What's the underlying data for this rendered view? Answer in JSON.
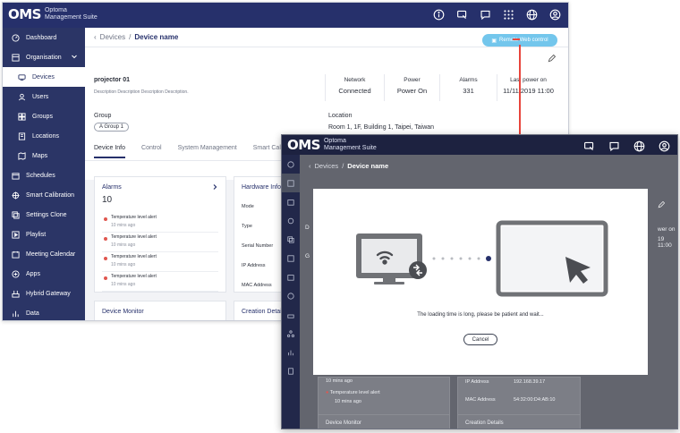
{
  "brand": {
    "logo": "OMS",
    "name_line1": "Optoma",
    "name_line2": "Management Suite"
  },
  "sidebar": {
    "items": [
      {
        "label": "Dashboard",
        "icon": "dashboard-icon"
      },
      {
        "label": "Organisation",
        "icon": "organisation-icon"
      },
      {
        "label": "Devices",
        "icon": "devices-icon"
      },
      {
        "label": "Users",
        "icon": "users-icon"
      },
      {
        "label": "Groups",
        "icon": "groups-icon"
      },
      {
        "label": "Locations",
        "icon": "locations-icon"
      },
      {
        "label": "Maps",
        "icon": "maps-icon"
      },
      {
        "label": "Schedules",
        "icon": "schedules-icon"
      },
      {
        "label": "Smart Calibration",
        "icon": "calibration-icon"
      },
      {
        "label": "Settings Clone",
        "icon": "clone-icon"
      },
      {
        "label": "Playlist",
        "icon": "playlist-icon"
      },
      {
        "label": "Meeting Calendar",
        "icon": "calendar-icon"
      },
      {
        "label": "Apps",
        "icon": "apps-icon"
      },
      {
        "label": "Hybrid Gateway",
        "icon": "gateway-icon"
      },
      {
        "label": "Data",
        "icon": "data-icon"
      }
    ]
  },
  "breadcrumb": {
    "parent": "Devices",
    "separator": "/",
    "current": "Device name"
  },
  "remote_button": "Remote Web control",
  "device": {
    "name": "projector 01",
    "description": "Description Description Description Description.",
    "stats": [
      {
        "label": "Network",
        "value": "Connected"
      },
      {
        "label": "Power",
        "value": "Power On"
      },
      {
        "label": "Alarms",
        "value": "331"
      },
      {
        "label": "Last power on",
        "value": "11/11/2019 11:00"
      }
    ],
    "group_label": "Group",
    "group_value": "A Group 1",
    "location_label": "Location",
    "location_value": "Room 1, 1F, Building 1, Taipei, Taiwan"
  },
  "tabs": [
    "Device Info",
    "Control",
    "System Management",
    "Smart Calibration"
  ],
  "alarms": {
    "title": "Alarms",
    "count": "10",
    "items": [
      {
        "text": "Temperature level alert",
        "time": "10 mins ago"
      },
      {
        "text": "Temperature level alert",
        "time": "10 mins ago"
      },
      {
        "text": "Temperature level alert",
        "time": "10 mins ago"
      },
      {
        "text": "Temperature level alert",
        "time": "10 mins ago"
      }
    ]
  },
  "hardware": {
    "title": "Hardware Info",
    "rows": [
      "Mode",
      "Type",
      "Serial Number",
      "IP Address",
      "MAC Address"
    ]
  },
  "monitor_title": "Device Monitor",
  "creation_title": "Creation Details",
  "overlay": {
    "breadcrumb_parent": "Devices",
    "breadcrumb_current": "Device name",
    "partial_power_on": "wer on",
    "partial_date": "19 11:00",
    "bottom_alarm_time": "10 mins ago",
    "bottom_alarm_text": "Temperature level alert",
    "bottom_alarm_time2": "10 mins ago",
    "ip_label": "IP Address",
    "ip_value": "192.168.39.17",
    "mac_label": "MAC Address",
    "mac_value": "54:32:00:D4:AB:10",
    "monitor_title": "Device Monitor",
    "creation_title": "Creation Details",
    "partial_d": "D",
    "partial_g": "G"
  },
  "modal": {
    "message": "The loading time is long, please be patient and wait...",
    "cancel": "Cancel"
  },
  "colors": {
    "topbar": "#26306b",
    "sidebar": "#2b3566",
    "accent": "#73c6ec",
    "alert": "#e0574f",
    "arrow": "#e8453c"
  }
}
